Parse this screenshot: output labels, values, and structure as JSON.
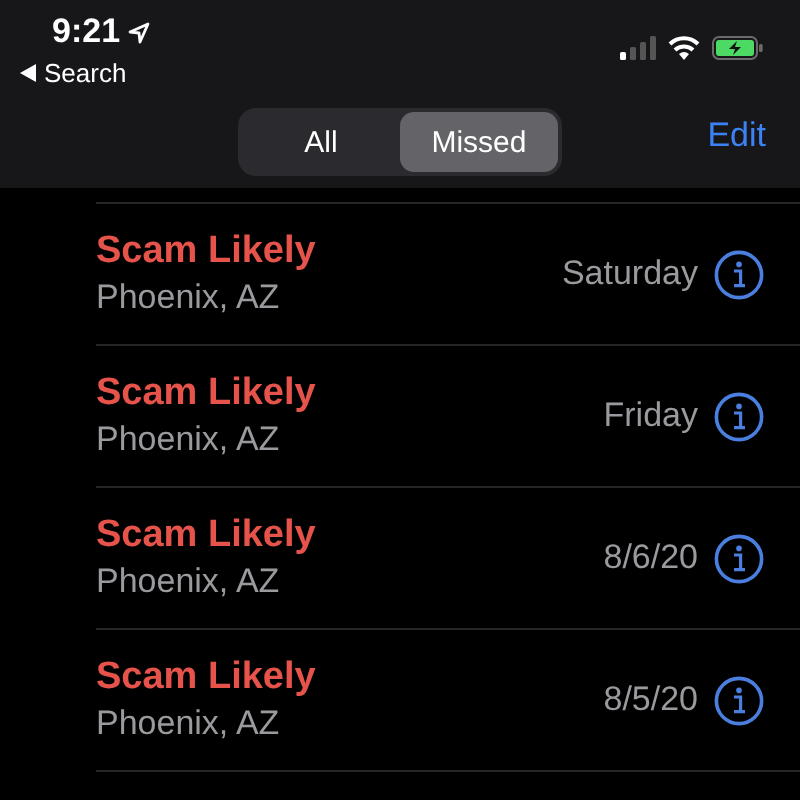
{
  "status_bar": {
    "time": "9:21",
    "back_label": "Search"
  },
  "segmented_control": [
    {
      "label": "All",
      "selected": false
    },
    {
      "label": "Missed",
      "selected": true
    }
  ],
  "edit_button": "Edit",
  "calls": [
    {
      "name": "Scam Likely",
      "location": "Phoenix, AZ",
      "date": "Saturday"
    },
    {
      "name": "Scam Likely",
      "location": "Phoenix, AZ",
      "date": "Friday"
    },
    {
      "name": "Scam Likely",
      "location": "Phoenix, AZ",
      "date": "8/6/20"
    },
    {
      "name": "Scam Likely",
      "location": "Phoenix, AZ",
      "date": "8/5/20"
    }
  ]
}
